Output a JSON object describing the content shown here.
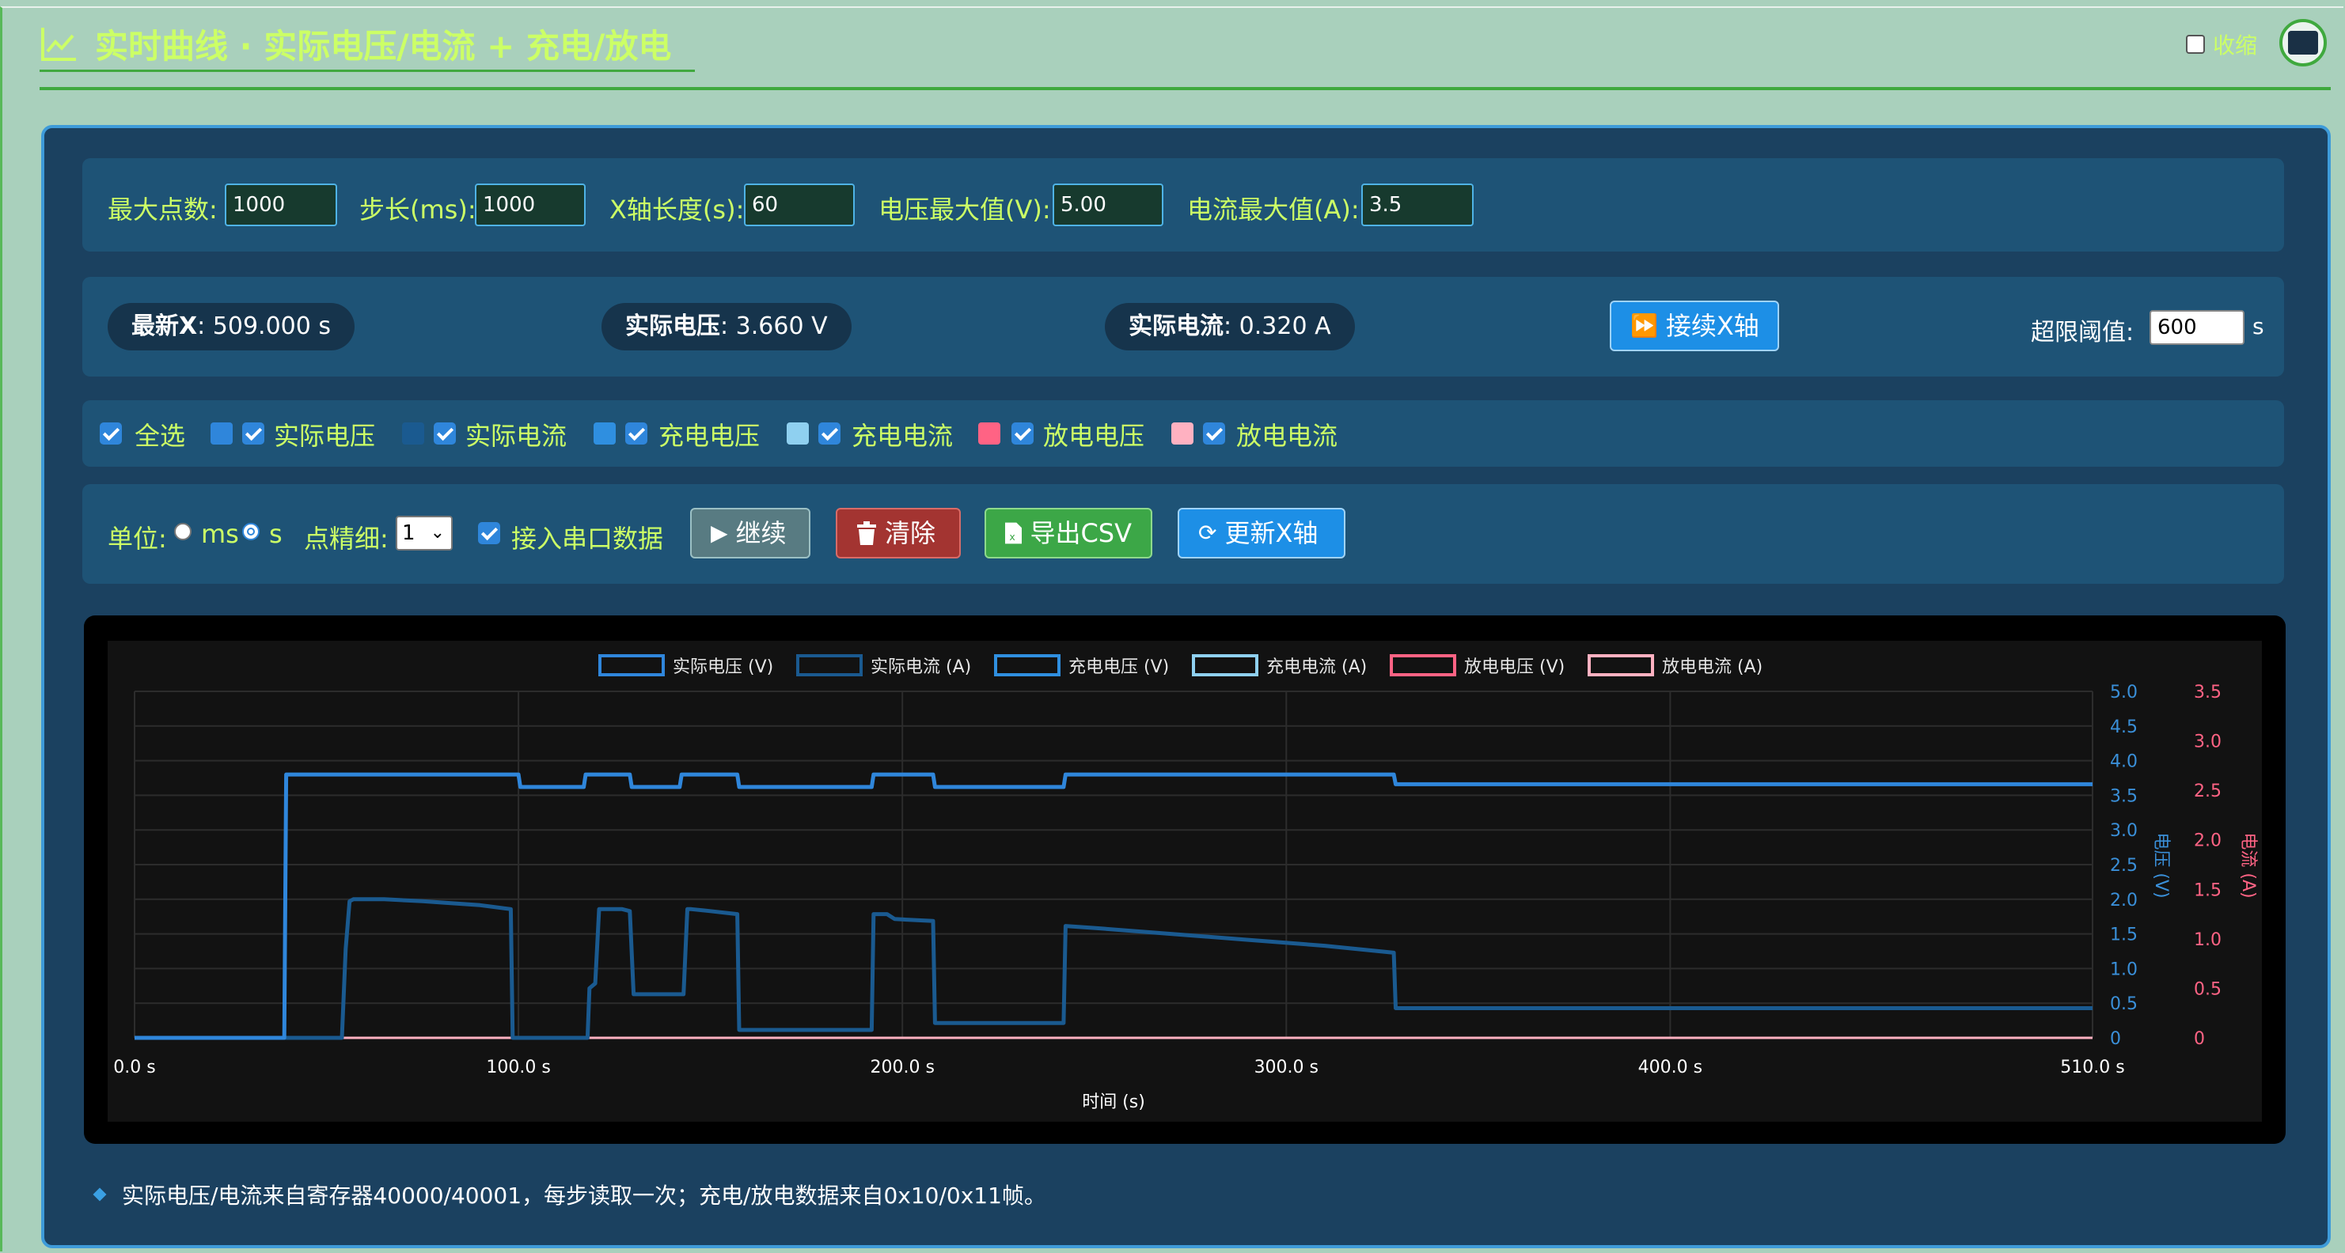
{
  "header": {
    "title": "实时曲线 · 实际电压/电流 + 充电/放电",
    "collapse_label": "收缩"
  },
  "settings": {
    "max_points_label": "最大点数:",
    "max_points": "1000",
    "step_label": "步长(ms):",
    "step": "1000",
    "xlen_label": "X轴长度(s):",
    "xlen": "60",
    "vmax_label": "电压最大值(V):",
    "vmax": "5.00",
    "imax_label": "电流最大值(A):",
    "imax": "3.5"
  },
  "status": {
    "latest_x_label": "最新X",
    "latest_x_value": ": 509.000 s",
    "voltage_label": "实际电压",
    "voltage_value": ": 3.660 V",
    "current_label": "实际电流",
    "current_value": ": 0.320 A",
    "follow_button": "接续X轴",
    "threshold_label": "超限阈值:",
    "threshold": "600",
    "threshold_unit": "s"
  },
  "series_toggles": {
    "select_all": "全选",
    "items": [
      {
        "label": "实际电压",
        "color": "#2f86db"
      },
      {
        "label": "实际电流",
        "color": "#1a5a90"
      },
      {
        "label": "充电电压",
        "color": "#2f8fe0"
      },
      {
        "label": "充电电流",
        "color": "#8fd0f0"
      },
      {
        "label": "放电电压",
        "color": "#ff6384"
      },
      {
        "label": "放电电流",
        "color": "#ffb1c1"
      }
    ]
  },
  "controls": {
    "unit_label": "单位:",
    "unit_ms": "ms",
    "unit_s": "s",
    "precision_label": "点精细:",
    "precision": "1",
    "serial_label": "接入串口数据",
    "continue_button": "继续",
    "clear_button": "清除",
    "export_button": "导出CSV",
    "update_button": "更新X轴"
  },
  "note": "实际电压/电流来自寄存器40000/40001，每步读取一次；充电/放电数据来自0x10/0x11帧。",
  "chart_data": {
    "type": "line",
    "xlabel": "时间 (s)",
    "ylabel_left": "电压 (V)",
    "ylabel_right": "电流 (A)",
    "xlim": [
      0,
      510
    ],
    "ylim_left": [
      0,
      5.0
    ],
    "ylim_right": [
      0,
      3.5
    ],
    "x_ticks": [
      "0.0 s",
      "100.0 s",
      "200.0 s",
      "300.0 s",
      "400.0 s",
      "510.0 s"
    ],
    "y_left_ticks": [
      "5.0",
      "4.5",
      "4.0",
      "3.5",
      "3.0",
      "2.5",
      "2.0",
      "1.5",
      "1.0",
      "0.5",
      "0"
    ],
    "y_right_ticks": [
      "3.5",
      "3.0",
      "2.5",
      "2.0",
      "1.5",
      "1.0",
      "0.5",
      "0"
    ],
    "legend_position": "top-center",
    "grid": true,
    "series": [
      {
        "name": "实际电压 (V)",
        "axis": "left",
        "color": "#2f86db",
        "x": [
          0,
          39,
          39.5,
          100,
          100.5,
          107,
          117,
          117.5,
          129,
          129.5,
          142,
          142.5,
          157,
          157.5,
          192,
          192.5,
          208,
          208.5,
          242,
          242.5,
          300,
          328,
          328.5,
          400,
          510
        ],
        "y": [
          0,
          0,
          3.8,
          3.8,
          3.62,
          3.62,
          3.62,
          3.8,
          3.8,
          3.62,
          3.62,
          3.8,
          3.8,
          3.62,
          3.62,
          3.8,
          3.8,
          3.62,
          3.62,
          3.8,
          3.8,
          3.8,
          3.66,
          3.66,
          3.66
        ]
      },
      {
        "name": "实际电流 (A)",
        "axis": "right",
        "color": "#1a5a90",
        "x": [
          0,
          54,
          55,
          56,
          57,
          65,
          75,
          90,
          98,
          98.5,
          118,
          118.5,
          120,
          121,
          127,
          129,
          130,
          143,
          144,
          145,
          150,
          157,
          157.5,
          192,
          192.5,
          196,
          198,
          208,
          208.5,
          242,
          242.5,
          250,
          270,
          290,
          310,
          328,
          328.5,
          400,
          510
        ],
        "y": [
          0,
          0,
          0.9,
          1.38,
          1.4,
          1.4,
          1.38,
          1.34,
          1.3,
          0,
          0,
          0.5,
          0.55,
          1.3,
          1.3,
          1.28,
          0.44,
          0.44,
          1.3,
          1.3,
          1.28,
          1.25,
          0.08,
          0.08,
          1.25,
          1.25,
          1.2,
          1.18,
          0.15,
          0.15,
          1.13,
          1.11,
          1.05,
          0.99,
          0.93,
          0.86,
          0.3,
          0.3,
          0.3
        ]
      },
      {
        "name": "充电电压 (V)",
        "axis": "left",
        "color": "#2f8fe0",
        "x": [
          0,
          510
        ],
        "y": [
          0,
          0
        ]
      },
      {
        "name": "充电电流 (A)",
        "axis": "right",
        "color": "#8fd0f0",
        "x": [
          0,
          510
        ],
        "y": [
          0,
          0
        ]
      },
      {
        "name": "放电电压 (V)",
        "axis": "left",
        "color": "#ff6384",
        "x": [
          0,
          510
        ],
        "y": [
          0,
          0
        ]
      },
      {
        "name": "放电电流 (A)",
        "axis": "right",
        "color": "#ffb1c1",
        "x": [
          0,
          510
        ],
        "y": [
          0,
          0
        ]
      }
    ]
  }
}
